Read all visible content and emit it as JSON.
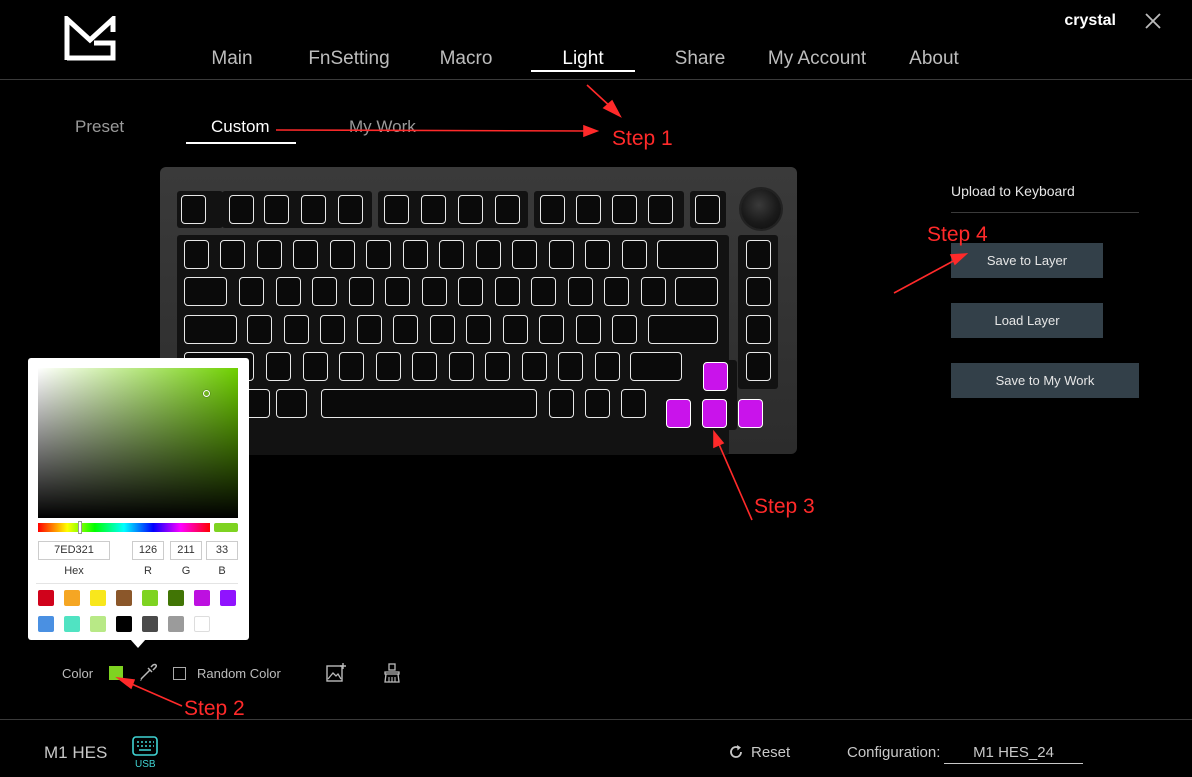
{
  "header": {
    "user": "crystal",
    "nav_tabs": [
      {
        "label": "Main"
      },
      {
        "label": "FnSetting"
      },
      {
        "label": "Macro"
      },
      {
        "label": "Light"
      },
      {
        "label": "Share"
      },
      {
        "label": "My Account"
      },
      {
        "label": "About"
      }
    ],
    "active_tab": "Light"
  },
  "sub_tabs": [
    {
      "label": "Preset"
    },
    {
      "label": "Custom"
    },
    {
      "label": "My Work"
    }
  ],
  "active_sub_tab": "Custom",
  "right_panel": {
    "upload_label": "Upload to Keyboard",
    "buttons": [
      {
        "label": "Save to Layer"
      },
      {
        "label": "Load Layer"
      },
      {
        "label": "Save to My Work"
      }
    ]
  },
  "keyboard": {
    "highlight_color": "#C913EB",
    "highlighted_keys": [
      "arrow-up",
      "arrow-left",
      "arrow-down",
      "arrow-right"
    ]
  },
  "color_picker": {
    "hex": "7ED321",
    "r": "126",
    "g": "211",
    "b": "33",
    "labels": {
      "hex": "Hex",
      "r": "R",
      "g": "G",
      "b": "B"
    },
    "selected_color": "#7ED321",
    "swatches_row1": [
      "#D0021B",
      "#F5A623",
      "#F8E71C",
      "#8B572A",
      "#7ED321",
      "#417505",
      "#BD10E0",
      "#9013FE"
    ],
    "swatches_row2": [
      "#4A90E2",
      "#50E3C2",
      "#B8E986",
      "#000000",
      "#4A4A4A",
      "#9B9B9B",
      "#FFFFFF"
    ]
  },
  "toolbar": {
    "color_label": "Color",
    "random_label": "Random Color",
    "random_checked": false
  },
  "footer": {
    "device": "M1 HES",
    "connection": "USB",
    "reset_label": "Reset",
    "config_label": "Configuration:",
    "config_value": "M1 HES_24"
  },
  "annotations": {
    "step1": "Step 1",
    "step2": "Step 2",
    "step3": "Step 3",
    "step4": "Step 4",
    "arrow_color": "#FF2A2A"
  }
}
